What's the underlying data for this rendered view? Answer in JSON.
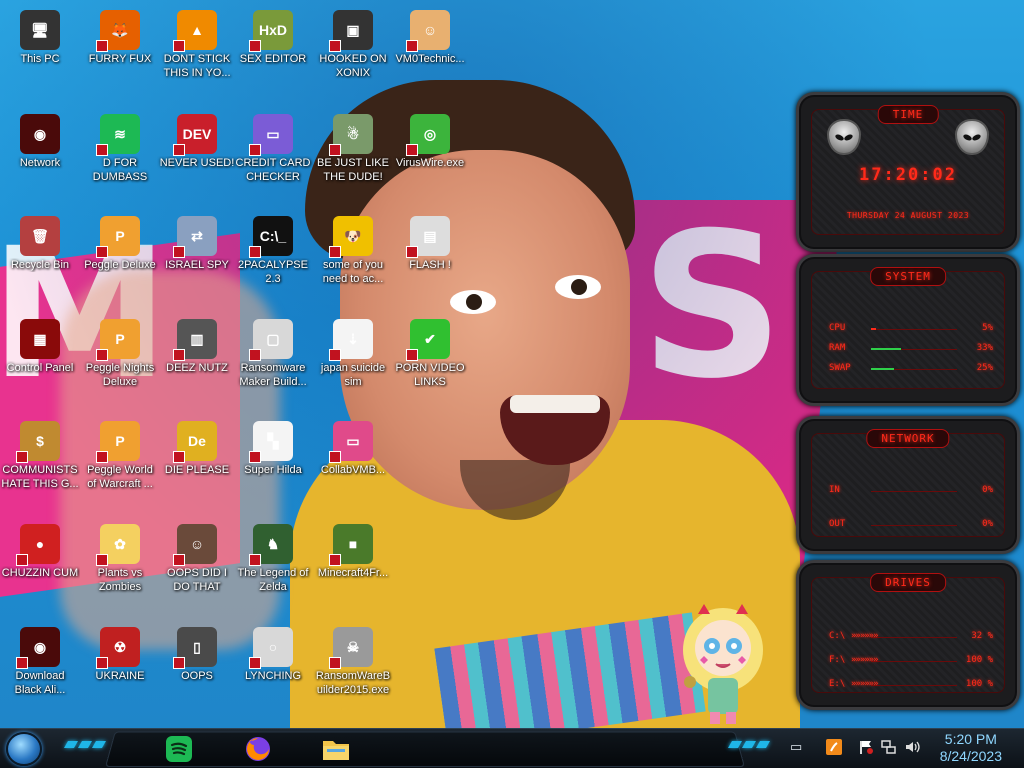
{
  "desktop": {
    "icons": [
      {
        "label": "This PC",
        "icon": "computer-icon",
        "color": "#333"
      },
      {
        "label": "FURRY FUX",
        "icon": "firefox-icon",
        "color": "#e66000"
      },
      {
        "label": "DONT STICK THIS IN YO...",
        "icon": "vlc-cone-icon",
        "color": "#f08a00"
      },
      {
        "label": "SEX EDITOR",
        "icon": "hxd-editor-icon",
        "color": "#7a9a3a"
      },
      {
        "label": "HOOKED ON XONIX",
        "icon": "xonix-game-icon",
        "color": "#333"
      },
      {
        "label": "VM0Technic...",
        "icon": "doctor-icon",
        "color": "#e8b070"
      },
      {
        "label": "Network",
        "icon": "alienware-network-icon",
        "color": "#4a0a0a"
      },
      {
        "label": "D FOR DUMBASS",
        "icon": "spotify-like-icon",
        "color": "#1db954"
      },
      {
        "label": "NEVER USED!",
        "icon": "dev-cpp-icon",
        "color": "#c91f2b"
      },
      {
        "label": "CREDIT CARD CHECKER",
        "icon": "credit-card-icon",
        "color": "#7b5cd6"
      },
      {
        "label": "BE JUST LIKE THE DUDE!",
        "icon": "santa-icon",
        "color": "#7a9a6a"
      },
      {
        "label": "VirusWire.exe",
        "icon": "lime-wire-icon",
        "color": "#3cb43c"
      },
      {
        "label": "Recycle Bin",
        "icon": "recycle-bin-icon",
        "color": "#b44040"
      },
      {
        "label": "Peggle Deluxe",
        "icon": "peggle-icon",
        "color": "#f0a030"
      },
      {
        "label": "ISRAEL SPY",
        "icon": "network-cable-icon",
        "color": "#8aa0c0"
      },
      {
        "label": "2PACALYPSE 2.3",
        "icon": "terminal-icon",
        "color": "#111"
      },
      {
        "label": "some of you need to ac...",
        "icon": "cartoon-dog-icon",
        "color": "#f0c000"
      },
      {
        "label": "FLASH !",
        "icon": "flash-folder-icon",
        "color": "#ddd"
      },
      {
        "label": "Control Panel",
        "icon": "control-panel-icon",
        "color": "#8a0a0a"
      },
      {
        "label": "Peggle Nights Deluxe",
        "icon": "peggle-nights-icon",
        "color": "#f0a030"
      },
      {
        "label": "DEEZ NUTZ",
        "icon": "stacked-windows-icon",
        "color": "#555"
      },
      {
        "label": "Ransomware Maker Build...",
        "icon": "window-app-icon",
        "color": "#d8d8d8"
      },
      {
        "label": "japan suicide sim",
        "icon": "arrows-icon",
        "color": "#f4f4f4"
      },
      {
        "label": "PORN VIDEO LINKS",
        "icon": "checkmark-icon",
        "color": "#30c030"
      },
      {
        "label": "COMMUNISTS HATE THIS G...",
        "icon": "money-bag-icon",
        "color": "#c08a30"
      },
      {
        "label": "Peggle World of Warcraft ...",
        "icon": "peggle-wow-icon",
        "color": "#f0a030"
      },
      {
        "label": "DIE PLEASE",
        "icon": "de-icon",
        "color": "#e0b020"
      },
      {
        "label": "Super Hilda",
        "icon": "pixel-sprite-icon",
        "color": "#f4f4f4"
      },
      {
        "label": "CollabVMB...",
        "icon": "pink-monitor-icon",
        "color": "#e04a8a"
      },
      {
        "label": "CHUZZIN CUM",
        "icon": "chuzzle-icon",
        "color": "#d02020"
      },
      {
        "label": "Plants vs Zombies",
        "icon": "plant-flower-icon",
        "color": "#f4d060"
      },
      {
        "label": "OOPS DID I DO THAT",
        "icon": "portrait-icon",
        "color": "#6a4a3a"
      },
      {
        "label": "The Legend of Zelda",
        "icon": "zelda-sprite-icon",
        "color": "#306030"
      },
      {
        "label": "Minecraft4Fr...",
        "icon": "minecraft-block-icon",
        "color": "#4a7a2a"
      },
      {
        "label": "Download Black Ali...",
        "icon": "alienware-icon",
        "color": "#4a0a0a"
      },
      {
        "label": "UKRAINE",
        "icon": "radiation-icon",
        "color": "#c02020"
      },
      {
        "label": "OOPS",
        "icon": "dark-app-icon",
        "color": "#4a4a4a"
      },
      {
        "label": "LYNCHING",
        "icon": "noose-icon",
        "color": "#d8d8d8"
      },
      {
        "label": "RansomWareBuilder2015.exe",
        "icon": "skull-icon",
        "color": "#9a9a9a"
      }
    ]
  },
  "gadget": {
    "time": {
      "title": "TIME",
      "clock": "17:20:02",
      "date": "THURSDAY 24 AUGUST 2023"
    },
    "system": {
      "title": "SYSTEM",
      "rows": [
        {
          "label": "CPU",
          "value": "5%",
          "fraction": 0.05
        },
        {
          "label": "RAM",
          "value": "33%",
          "fraction": 0.33
        },
        {
          "label": "SWAP",
          "value": "25%",
          "fraction": 0.25
        }
      ]
    },
    "network": {
      "title": "NETWORK",
      "rows": [
        {
          "label": "IN",
          "value": "0%"
        },
        {
          "label": "OUT",
          "value": "0%"
        }
      ]
    },
    "drives": {
      "title": "DRIVES",
      "rows": [
        {
          "label": "C:\\",
          "value": "32 %"
        },
        {
          "label": "F:\\",
          "value": "100 %"
        },
        {
          "label": "E:\\",
          "value": "100 %"
        }
      ]
    }
  },
  "taskbar": {
    "apps": [
      {
        "name": "spotify-app",
        "icon": "spotify-icon",
        "color": "#1db954"
      },
      {
        "name": "firefox-app",
        "icon": "firefox-icon",
        "color": "#e66000"
      },
      {
        "name": "file-explorer-app",
        "icon": "folder-icon",
        "color": "#f0c040"
      }
    ],
    "tray": [
      "java-icon",
      "flag-icon",
      "network-icon",
      "volume-icon"
    ],
    "clock": {
      "time": "5:20 PM",
      "date": "8/24/2023"
    }
  }
}
